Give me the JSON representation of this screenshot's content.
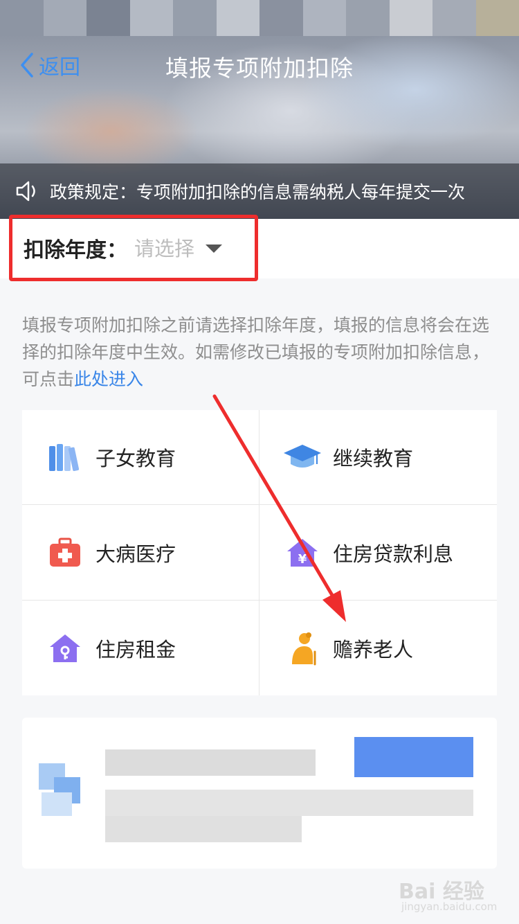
{
  "nav": {
    "back_label": "返回",
    "title": "填报专项附加扣除"
  },
  "notice": {
    "text": "政策规定：专项附加扣除的信息需纳税人每年提交一次",
    "icon": "speaker-icon"
  },
  "year": {
    "label": "扣除年度：",
    "placeholder": "请选择",
    "icon": "caret-down-icon"
  },
  "info": {
    "text": "填报专项附加扣除之前请选择扣除年度，填报的信息将会在选择的扣除年度中生效。如需修改已填报的专项附加扣除信息，可点击",
    "link": "此处进入"
  },
  "categories": [
    {
      "label": "子女教育",
      "icon": "books-icon"
    },
    {
      "label": "继续教育",
      "icon": "graduation-cap-icon"
    },
    {
      "label": "大病医疗",
      "icon": "medical-kit-icon"
    },
    {
      "label": "住房贷款利息",
      "icon": "house-loan-icon"
    },
    {
      "label": "住房租金",
      "icon": "house-key-icon"
    },
    {
      "label": "赡养老人",
      "icon": "elderly-icon"
    }
  ],
  "watermark": {
    "brand": "Bai 经验",
    "url": "jingyan.baidu.com"
  },
  "colors": {
    "accent": "#3a86e8",
    "highlight": "#ee2d2d",
    "icon_blue": "#5aa0f0",
    "icon_purple": "#8c6ff0",
    "icon_red": "#f05a4f",
    "icon_orange": "#f5a623"
  }
}
